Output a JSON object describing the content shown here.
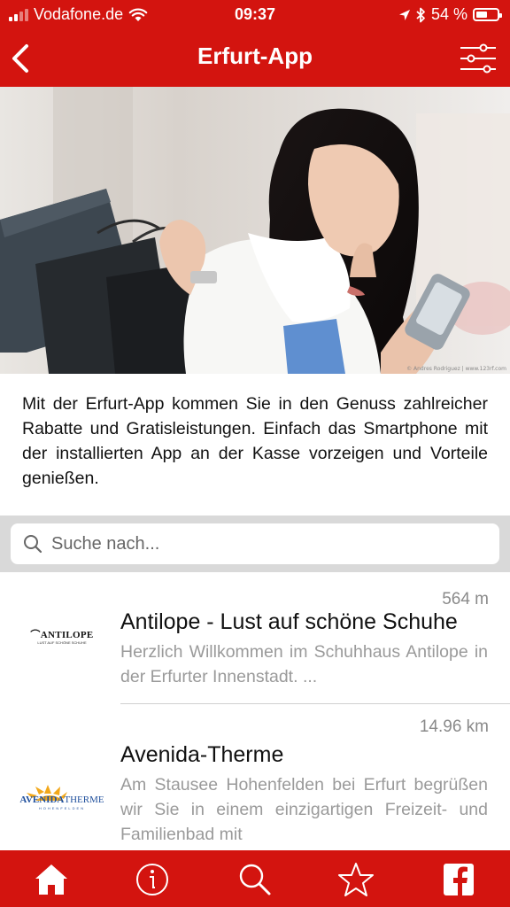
{
  "status_bar": {
    "carrier": "Vodafone.de",
    "time": "09:37",
    "battery_text": "54 %",
    "battery_level": 0.54,
    "icons": [
      "signal-icon",
      "wifi-icon",
      "location-arrow-icon",
      "bluetooth-icon",
      "battery-icon"
    ]
  },
  "nav": {
    "title": "Erfurt-App",
    "left_icon": "back-chevron-icon",
    "right_icon": "filter-sliders-icon"
  },
  "hero": {
    "credit": "© Andres Rodriguez | www.123rf.com"
  },
  "intro": {
    "text": "Mit der Erfurt-App kommen Sie in den Genuss zahlreicher Rabatte und Gratisleistungen. Einfach das Smartphone mit der installierten App an der Kasse vorzeigen und Vorteile genießen."
  },
  "search": {
    "placeholder": "Suche nach...",
    "value": ""
  },
  "list": {
    "items": [
      {
        "distance": "564 m",
        "title": "Antilope - Lust auf schöne Schuhe",
        "description": "Herzlich Willkommen im Schuhhaus Antilope in der Erfurter Innenstadt. ...",
        "logo_text": "ANTILOPE",
        "logo_subtext": "LUST AUF SCHÖNE SCHUHE"
      },
      {
        "distance": "14.96 km",
        "title": "Avenida-Therme",
        "description": "Am Stausee Hohenfelden bei Erfurt begrüßen wir Sie in einem einzigartigen Freizeit- und Familienbad mit",
        "logo_text_1": "AVENIDA",
        "logo_text_2": "THERME",
        "logo_subtext": "HOHENFELDEN"
      }
    ]
  },
  "tabs": [
    {
      "icon": "home-icon"
    },
    {
      "icon": "info-icon"
    },
    {
      "icon": "search-icon"
    },
    {
      "icon": "star-icon"
    },
    {
      "icon": "facebook-icon"
    }
  ],
  "colors": {
    "brand_red": "#d3140f",
    "search_bg": "#d9d9d9",
    "muted_text": "#9a9a9a"
  }
}
